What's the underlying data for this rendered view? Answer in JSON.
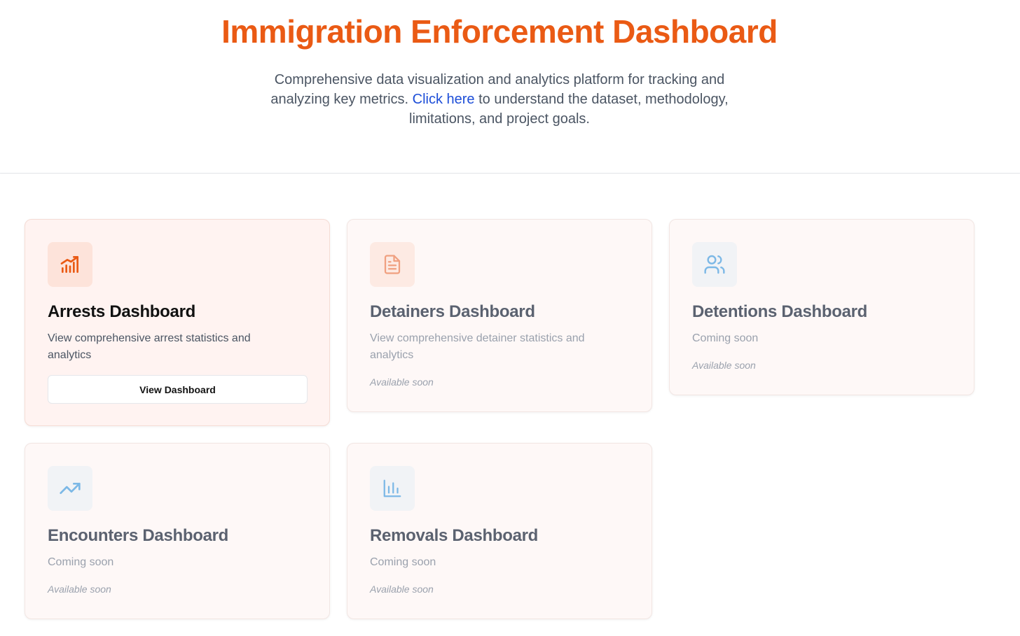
{
  "header": {
    "title": "Immigration Enforcement Dashboard",
    "subtitle_pre": "Comprehensive data visualization and analytics platform for tracking and analyzing key metrics. ",
    "subtitle_link": "Click here",
    "subtitle_post": " to understand the dataset, methodology, limitations, and project goals."
  },
  "cards": [
    {
      "title": "Arrests Dashboard",
      "description": "View comprehensive arrest statistics and analytics",
      "button_label": "View Dashboard",
      "icon": "chart-increasing-icon",
      "status": "active"
    },
    {
      "title": "Detainers Dashboard",
      "description": "View comprehensive detainer statistics and analytics",
      "availability": "Available soon",
      "icon": "document-icon",
      "status": "disabled"
    },
    {
      "title": "Detentions Dashboard",
      "description": "Coming soon",
      "availability": "Available soon",
      "icon": "users-icon",
      "status": "disabled"
    },
    {
      "title": "Encounters Dashboard",
      "description": "Coming soon",
      "availability": "Available soon",
      "icon": "trending-up-icon",
      "status": "disabled"
    },
    {
      "title": "Removals Dashboard",
      "description": "Coming soon",
      "availability": "Available soon",
      "icon": "bar-chart-icon",
      "status": "disabled"
    }
  ],
  "colors": {
    "title": "#ea5a14",
    "link": "#1d4ed8",
    "icon_orange": "#ea5a14",
    "icon_light_orange": "#f0a080",
    "icon_blue": "#7cb8e6"
  }
}
